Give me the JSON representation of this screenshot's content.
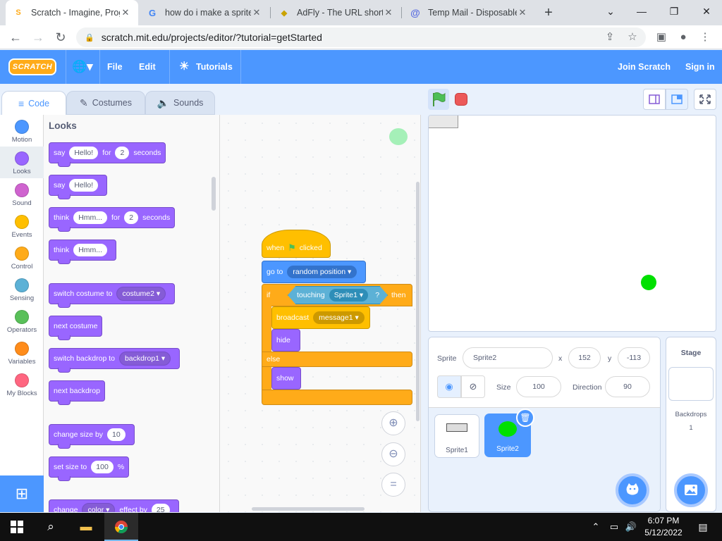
{
  "browser": {
    "tabs": [
      {
        "title": "Scratch - Imagine, Program",
        "close": "✕"
      },
      {
        "title": "how do i make a sprite",
        "close": "✕"
      },
      {
        "title": "AdFly - The URL shortener",
        "close": "✕"
      },
      {
        "title": "Temp Mail - Disposable",
        "close": "✕"
      }
    ],
    "url": "scratch.mit.edu/projects/editor/?tutorial=getStarted"
  },
  "menu": {
    "logo": "SCRATCH",
    "file": "File",
    "edit": "Edit",
    "tutorials": "Tutorials",
    "join": "Join Scratch",
    "signin": "Sign in"
  },
  "editor_tabs": {
    "code": "Code",
    "costumes": "Costumes",
    "sounds": "Sounds"
  },
  "categories": [
    {
      "label": "Motion",
      "color": "#4c97ff"
    },
    {
      "label": "Looks",
      "color": "#9966ff"
    },
    {
      "label": "Sound",
      "color": "#cf63cf"
    },
    {
      "label": "Events",
      "color": "#ffbf00"
    },
    {
      "label": "Control",
      "color": "#ffab19"
    },
    {
      "label": "Sensing",
      "color": "#5cb1d6"
    },
    {
      "label": "Operators",
      "color": "#59c059"
    },
    {
      "label": "Variables",
      "color": "#ff8c1a"
    },
    {
      "label": "My Blocks",
      "color": "#ff6680"
    }
  ],
  "palette": {
    "title": "Looks",
    "say": "say",
    "think": "think",
    "hello": "Hello!",
    "hmm": "Hmm...",
    "for": "for",
    "two": "2",
    "seconds": "seconds",
    "switch_costume": "switch costume to",
    "costume2": "costume2",
    "next_costume": "next costume",
    "switch_backdrop": "switch backdrop to",
    "backdrop1": "backdrop1",
    "next_backdrop": "next backdrop",
    "change_size": "change size by",
    "ten": "10",
    "set_size": "set size to",
    "hundred": "100",
    "percent": "%",
    "change": "change",
    "color": "color",
    "effect_by": "effect by",
    "twentyfive": "25"
  },
  "script": {
    "when": "when",
    "clicked": "clicked",
    "goto": "go to",
    "random": "random position",
    "if": "if",
    "touching": "touching",
    "sprite1": "Sprite1",
    "q": "?",
    "then": "then",
    "broadcast": "broadcast",
    "message1": "message1",
    "hide": "hide",
    "else": "else",
    "show": "show"
  },
  "sprite_info": {
    "sprite_label": "Sprite",
    "sprite_name": "Sprite2",
    "x_label": "x",
    "x": "152",
    "y_label": "y",
    "y": "-113",
    "size_label": "Size",
    "size": "100",
    "direction_label": "Direction",
    "direction": "90"
  },
  "sprites": [
    {
      "name": "Sprite1",
      "selected": false
    },
    {
      "name": "Sprite2",
      "selected": true
    }
  ],
  "stage_pane": {
    "title": "Stage",
    "backdrops_label": "Backdrops",
    "backdrops_count": "1"
  },
  "taskbar": {
    "time": "6:07 PM",
    "date": "5/12/2022"
  }
}
